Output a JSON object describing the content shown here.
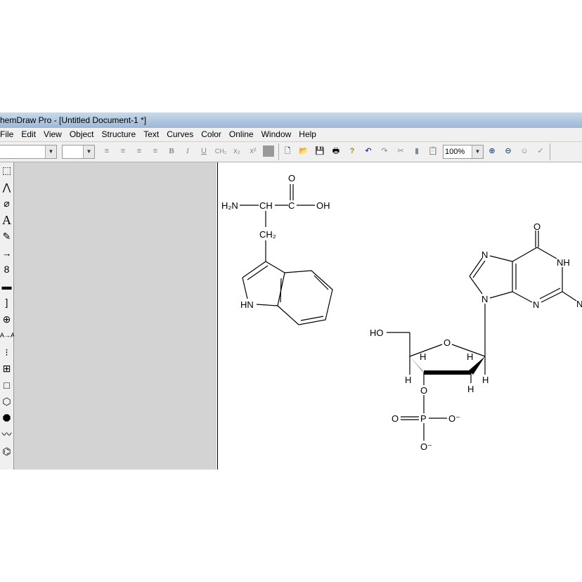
{
  "window": {
    "title": "hemDraw Pro - [Untitled Document-1 *]"
  },
  "menu": [
    "File",
    "Edit",
    "View",
    "Object",
    "Structure",
    "Text",
    "Curves",
    "Color",
    "Online",
    "Window",
    "Help"
  ],
  "toolbar": {
    "zoom_value": "100%",
    "ch2": "CH₂",
    "sub": "x₂",
    "sup": "x²",
    "bold": "B",
    "italic": "I",
    "underline": "U"
  },
  "tools": [
    "select-icon",
    "chain-icon",
    "eraser-icon",
    "text-icon",
    "pen-icon",
    "arrow-icon",
    "orbital-icon",
    "bracket-icon",
    "bracket-right-icon",
    "charge-icon",
    "mass-icon",
    "template-icon",
    "table-icon",
    "rectangle-icon",
    "cyclohexane-icon",
    "cyclooctane-icon",
    "wave-icon",
    "benzene-icon"
  ],
  "molecule1": {
    "labels": {
      "h2n": "H₂N",
      "ch": "CH",
      "c": "C",
      "oh": "OH",
      "o": "O",
      "ch2": "CH₂",
      "hn": "HN"
    }
  },
  "molecule2": {
    "labels": {
      "o_top": "O",
      "nh": "NH",
      "n_right": "N",
      "n3": "N",
      "n7": "N",
      "n9": "N",
      "ho": "HO",
      "o_ring": "O",
      "h": "H",
      "o3": "O",
      "p": "P",
      "o_dbl": "O",
      "o_minus": "O⁻"
    }
  }
}
